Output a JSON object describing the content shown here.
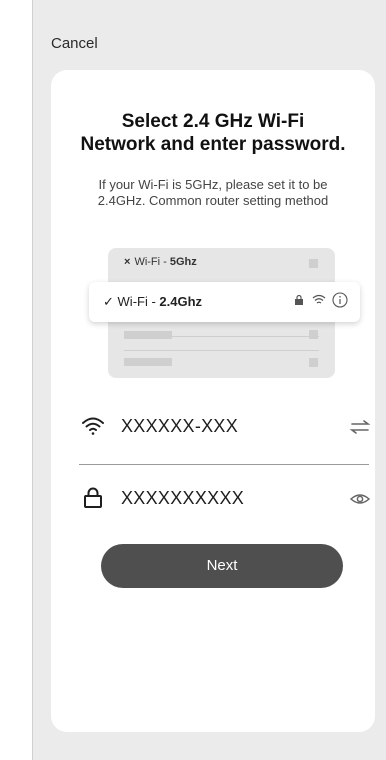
{
  "header": {
    "cancel_label": "Cancel"
  },
  "main": {
    "title_line1": "Select 2.4 GHz Wi-Fi",
    "title_line2": "Network and enter password.",
    "subtitle_line1": "If your Wi-Fi is 5GHz, please set it to be",
    "subtitle_line2": "2.4GHz. Common router setting method"
  },
  "illustration": {
    "row_5ghz_prefix": "Wi-Fi - ",
    "row_5ghz_band": "5Ghz",
    "row_5ghz_mark": "×",
    "row_24_prefix": "Wi-Fi - ",
    "row_24_band": "2.4Ghz",
    "row_24_mark": "✓"
  },
  "form": {
    "ssid_value": "XXXXXX-XXX",
    "password_value": "XXXXXXXXXX",
    "next_label": "Next"
  },
  "icons": {
    "wifi": "wifi-icon",
    "switch": "switch-arrows-icon",
    "lock": "lock-icon",
    "eye": "eye-icon"
  }
}
